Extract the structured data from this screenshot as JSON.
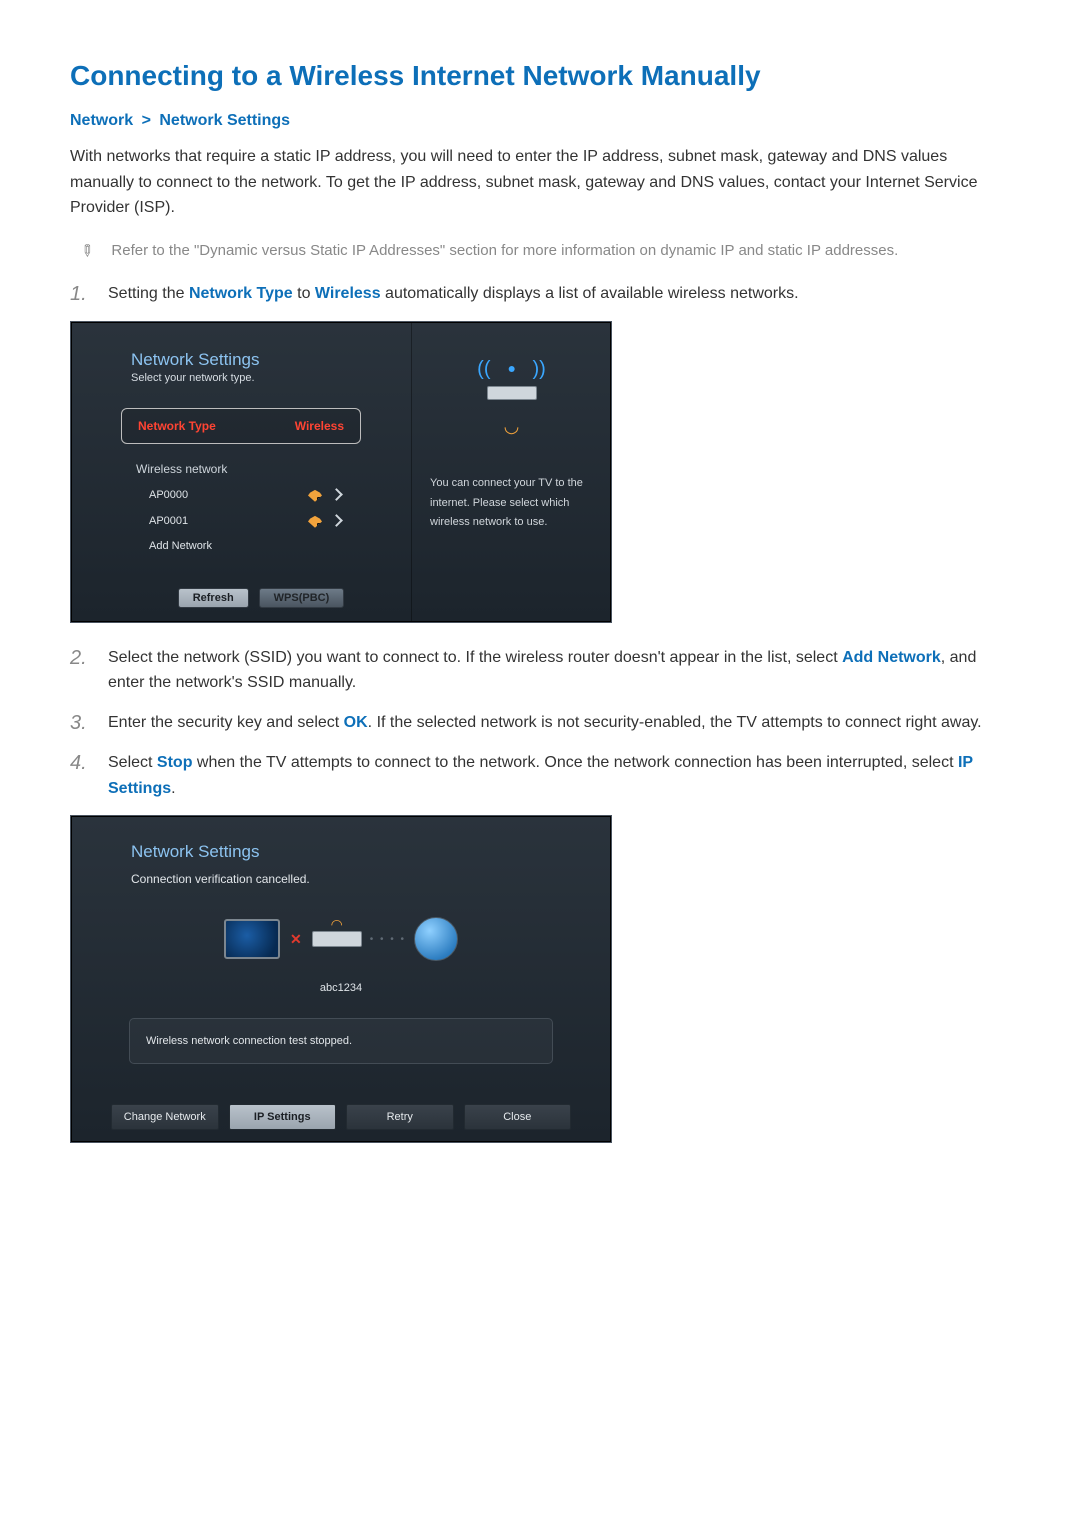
{
  "title": "Connecting to a Wireless Internet Network Manually",
  "breadcrumb": {
    "a": "Network",
    "sep": ">",
    "b": "Network Settings"
  },
  "intro": "With networks that require a static IP address, you will need to enter the IP address, subnet mask, gateway and DNS values manually to connect to the network. To get the IP address, subnet mask, gateway and DNS values, contact your Internet Service Provider (ISP).",
  "note": "Refer to the \"Dynamic versus Static IP Addresses\" section for more information on dynamic IP and static IP addresses.",
  "steps": {
    "s1_a": "Setting the ",
    "s1_b": "Network Type",
    "s1_c": " to ",
    "s1_d": "Wireless",
    "s1_e": " automatically displays a list of available wireless networks.",
    "s2_a": "Select the network (SSID) you want to connect to. If the wireless router doesn't appear in the list, select ",
    "s2_b": "Add Network",
    "s2_c": ", and enter the network's SSID manually.",
    "s3_a": "Enter the security key and select ",
    "s3_b": "OK",
    "s3_c": ". If the selected network is not security-enabled, the TV attempts to connect right away.",
    "s4_a": "Select ",
    "s4_b": "Stop",
    "s4_c": " when the TV attempts to connect to the network. Once the network connection has been interrupted, select ",
    "s4_d": "IP Settings",
    "s4_e": "."
  },
  "shot1": {
    "title": "Network Settings",
    "subtitle": "Select your network type.",
    "networkType_label": "Network Type",
    "networkType_value": "Wireless",
    "wireless_label": "Wireless network",
    "items": [
      "AP0000",
      "AP0001",
      "Add Network"
    ],
    "btn_refresh": "Refresh",
    "btn_wps": "WPS(PBC)",
    "hint_l1": "You can connect your TV to the",
    "hint_l2": "internet. Please select which",
    "hint_l3": "wireless network to use."
  },
  "shot2": {
    "title": "Network Settings",
    "status": "Connection verification cancelled.",
    "router_name": "abc1234",
    "stopped": "Wireless network connection test stopped.",
    "btn_change": "Change Network",
    "btn_ip": "IP Settings",
    "btn_retry": "Retry",
    "btn_close": "Close"
  },
  "nums": {
    "n1": "1.",
    "n2": "2.",
    "n3": "3.",
    "n4": "4."
  }
}
